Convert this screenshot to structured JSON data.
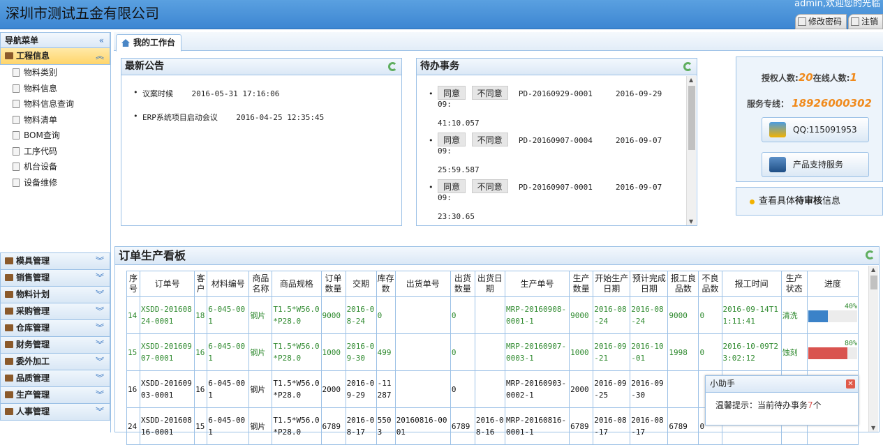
{
  "header": {
    "company": "深圳市测试五金有限公司",
    "user_info": "admin,欢迎您的光临",
    "change_password": "修改密码",
    "logout": "注销"
  },
  "sidebar": {
    "title": "导航菜单",
    "collapse_glyph": "«",
    "active_group": "工程信息",
    "sub_items": [
      "物料类别",
      "物料信息",
      "物料信息查询",
      "物料清单",
      "BOM查询",
      "工序代码",
      "机台设备",
      "设备维修"
    ],
    "groups": [
      "模具管理",
      "销售管理",
      "物料计划",
      "采购管理",
      "仓库管理",
      "财务管理",
      "委外加工",
      "品质管理",
      "生产管理",
      "人事管理"
    ]
  },
  "tab": {
    "label": "我的工作台"
  },
  "announcements": {
    "title": "最新公告",
    "items": [
      {
        "text": "议案时候",
        "date": "2016-05-31 17:16:06"
      },
      {
        "text": "ERP系统项目启动会议",
        "date": "2016-04-25 12:35:45"
      }
    ]
  },
  "todo": {
    "title": "待办事务",
    "agree": "同意",
    "disagree": "不同意",
    "items": [
      {
        "code": "PD-20160929-0001",
        "date": "2016-09-29 09:",
        "time": "41:10.057"
      },
      {
        "code": "PD-20160907-0004",
        "date": "2016-09-07 09:",
        "time": "25:59.587"
      },
      {
        "code": "PD-20160907-0001",
        "date": "2016-09-07 09:",
        "time": "23:30.65"
      }
    ]
  },
  "info": {
    "licensed_label": "授权人数:",
    "licensed_value": "20",
    "online_label": "在线人数:",
    "online_value": "1",
    "hotline_label": "服务专线：",
    "hotline_value": "18926000302",
    "qq": "QQ:115091953",
    "support": "产品支持服务",
    "check_prefix": "查看具体",
    "check_bold": "待审核",
    "check_suffix": "信息"
  },
  "board": {
    "title": "订单生产看板",
    "columns": [
      "序号",
      "订单号",
      "客户",
      "材料编号",
      "商品名称",
      "商品规格",
      "订单数量",
      "交期",
      "库存数",
      "出货单号",
      "出货数量",
      "出货日期",
      "生产单号",
      "生产数量",
      "开始生产日期",
      "预计完成日期",
      "报工良品数",
      "不良品数",
      "报工时间",
      "生产状态",
      "进度"
    ],
    "rows": [
      {
        "cells": [
          "14",
          "XSDD-20160824-0001",
          "18",
          "6-045-001",
          "钢片",
          "T1.5*W56.0*P28.0",
          "9000",
          "2016-08-24",
          "0",
          "",
          "0",
          "",
          "MRP-20160908-0001-1",
          "9000",
          "2016-08-24",
          "2016-08-24",
          "9000",
          "0",
          "2016-09-14T11:11:41",
          "清洗"
        ],
        "progress": 40,
        "progress_label": "40%",
        "color": "#3b82c8",
        "style": "green"
      },
      {
        "cells": [
          "15",
          "XSDD-20160907-0001",
          "16",
          "6-045-001",
          "钢片",
          "T1.5*W56.0*P28.0",
          "1000",
          "2016-09-30",
          "499",
          "",
          "0",
          "",
          "MRP-20160907-0003-1",
          "1000",
          "2016-09-21",
          "2016-10-01",
          "1998",
          "0",
          "2016-10-09T23:02:12",
          "蚀刻"
        ],
        "progress": 80,
        "progress_label": "80%",
        "color": "#d9534f",
        "style": "green"
      },
      {
        "cells": [
          "16",
          "XSDD-20160903-0001",
          "16",
          "6-045-001",
          "钢片",
          "T1.5*W56.0*P28.0",
          "2000",
          "2016-09-29",
          "-11287",
          "",
          "0",
          "",
          "MRP-20160903-0002-1",
          "2000",
          "2016-09-25",
          "2016-09-30",
          "",
          "",
          "",
          ""
        ],
        "progress": null,
        "progress_label": "",
        "color": "",
        "style": "black"
      },
      {
        "cells": [
          "24",
          "XSDD-20160816-0001",
          "15",
          "6-045-001",
          "钢片",
          "T1.5*W56.0*P28.0",
          "6789",
          "2016-08-17",
          "5503",
          "20160816-0001",
          "6789",
          "2016-08-16",
          "MRP-20160816-0001-1",
          "6789",
          "2016-08-17",
          "2016-08-17",
          "6789",
          "0",
          "",
          ""
        ],
        "progress": null,
        "progress_label": "",
        "color": "",
        "style": "black"
      }
    ]
  },
  "helper": {
    "title": "小助手",
    "msg_prefix": "温馨提示：当前待办事务",
    "msg_count": "7",
    "msg_suffix": "个"
  }
}
